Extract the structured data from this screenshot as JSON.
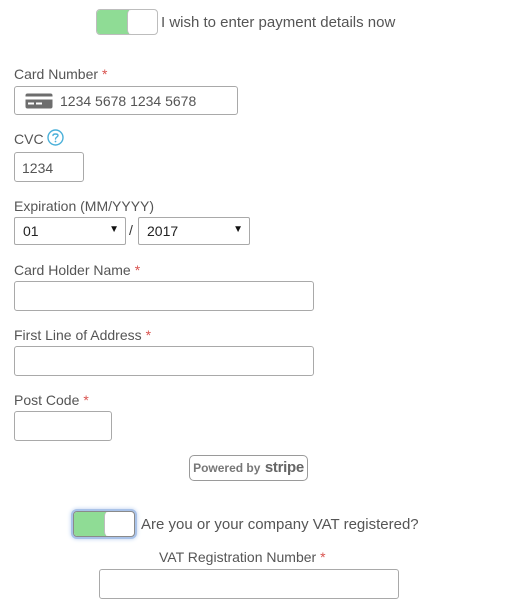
{
  "payment_toggle": {
    "label": "I wish to enter payment details now",
    "state": "on"
  },
  "card_number": {
    "label": "Card Number",
    "required_mark": "*",
    "value": "1234 5678 1234 5678",
    "icon": "credit-card-icon"
  },
  "cvc": {
    "label": "CVC",
    "help_icon": "question-circle-icon",
    "value": "1234"
  },
  "expiration": {
    "label": "Expiration (MM/YYYY)",
    "month": "01",
    "separator": "/",
    "year": "2017"
  },
  "card_holder": {
    "label": "Card Holder Name",
    "required_mark": "*",
    "value": ""
  },
  "address_line1": {
    "label": "First Line of Address",
    "required_mark": "*",
    "value": ""
  },
  "post_code": {
    "label": "Post Code",
    "required_mark": "*",
    "value": ""
  },
  "stripe_badge": {
    "powered_by": "Powered by",
    "brand": "stripe"
  },
  "vat_toggle": {
    "label": "Are you or your company VAT registered?",
    "state": "on"
  },
  "vat_number": {
    "label": "VAT Registration Number",
    "required_mark": "*",
    "value": ""
  },
  "colors": {
    "toggle_on": "#8fdc95",
    "required": "#d9534f",
    "help_icon": "#4ab0d9",
    "text": "#555555"
  }
}
